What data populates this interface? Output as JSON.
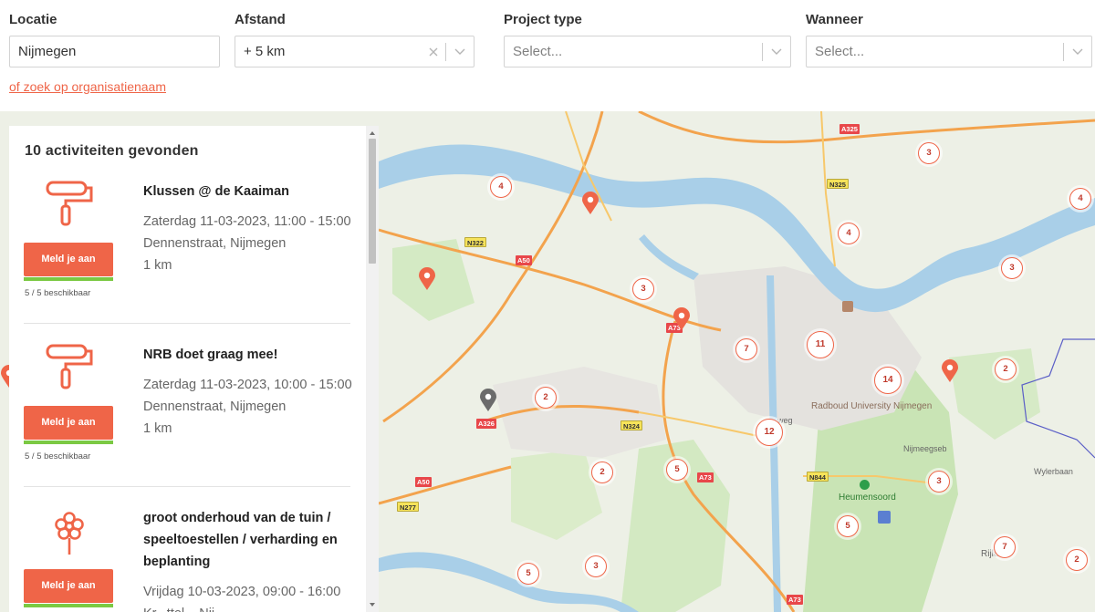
{
  "filters": {
    "location": {
      "label": "Locatie",
      "value": "Nijmegen"
    },
    "distance": {
      "label": "Afstand",
      "value": "+ 5 km"
    },
    "project_type": {
      "label": "Project type",
      "placeholder": "Select..."
    },
    "when": {
      "label": "Wanneer",
      "placeholder": "Select..."
    },
    "org_search_link": "of zoek op organisatienaam"
  },
  "results": {
    "count_label": "10 activiteiten gevonden",
    "activities": [
      {
        "icon": "paint-roller-icon",
        "title": "Klussen @ de Kaaiman",
        "datetime": "Zaterdag 11-03-2023,  11:00 - 15:00",
        "address": "Dennenstraat, Nijmegen",
        "distance": "1 km",
        "button": "Meld je aan",
        "availability": "5 / 5 beschikbaar",
        "availability_fraction": 1.0
      },
      {
        "icon": "paint-roller-icon",
        "title": "NRB doet graag mee!",
        "datetime": "Zaterdag 11-03-2023,  10:00 - 15:00",
        "address": "Dennenstraat, Nijmegen",
        "distance": "1 km",
        "button": "Meld je aan",
        "availability": "5 / 5 beschikbaar",
        "availability_fraction": 1.0
      },
      {
        "icon": "flower-icon",
        "title_lines": [
          "groot onderhoud van de tuin /",
          "speeltoestellen / verharding en",
          "beplanting"
        ],
        "datetime": "Vrijdag 10-03-2023,  09:00 - 16:00",
        "address_partial": "Kr...ttel...  Nij...",
        "button": "Meld je aan"
      }
    ]
  },
  "map": {
    "clusters": [
      "3",
      "4",
      "4",
      "4",
      "3",
      "3",
      "7",
      "11",
      "14",
      "2",
      "2",
      "12",
      "2",
      "5",
      "3",
      "5",
      "2",
      "7",
      "5",
      "3"
    ],
    "road_labels": [
      "A325",
      "N325",
      "N322",
      "A50",
      "A73",
      "A326",
      "N324",
      "A73",
      "N844",
      "A50",
      "N277",
      "A73"
    ],
    "place_labels": [
      "Radboud University Nijmegen",
      "Heumensoord",
      "Rijlaan",
      "Wylerbaan",
      "Nijmeegseb",
      "weg"
    ],
    "colors": {
      "accent": "#ef6548",
      "available": "#7bc943",
      "water": "#a9cfe8",
      "park": "#c7e3b3",
      "highway": "#f3a34d"
    }
  }
}
